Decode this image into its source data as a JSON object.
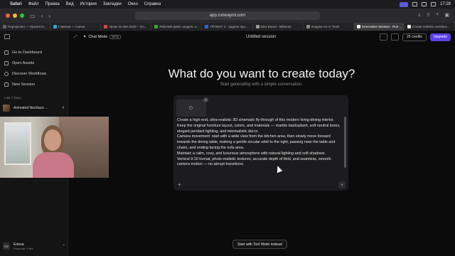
{
  "menubar": {
    "app": "Safari",
    "items": [
      "Файл",
      "Правка",
      "Вид",
      "История",
      "Закладки",
      "Окно",
      "Справка"
    ],
    "time": "17:28"
  },
  "browser": {
    "address": "app.runwayml.com",
    "tabs": [
      {
        "label": "Портфолио — Презента..."
      },
      {
        "label": "Главная — Canva"
      },
      {
        "label": "Уроки по Wei 2025 – Go..."
      },
      {
        "label": "Рабочий файл, модель 4..."
      },
      {
        "label": "ПРОЕКТ 2 - Задачи про..."
      },
      {
        "label": "New Board - Miliarote"
      },
      {
        "label": "Imagine Art AI Tools"
      },
      {
        "label": "Generative Session - Run..."
      },
      {
        "label": "Create realistic necklace..."
      }
    ],
    "active_tab": 7
  },
  "sidebar": {
    "nav": [
      {
        "label": "Go to Dashboard",
        "icon": "dashboard-icon"
      },
      {
        "label": "Open Assets",
        "icon": "folder-icon"
      },
      {
        "label": "Discover Workflows",
        "icon": "globe-icon"
      },
      {
        "label": "New Session",
        "icon": "plus-icon"
      }
    ],
    "section_title": "Last 7 Days",
    "sessions": [
      {
        "label": "Animated Necklace ...",
        "count": "4"
      }
    ],
    "user": {
      "initials": "ER",
      "name": "Елена",
      "plan": "Personal · Free"
    }
  },
  "topbar": {
    "mode_label": "Chat Mode",
    "beta": "BETA",
    "session_title": "Untitled session",
    "credits": "25 credits",
    "upgrade": "Upgrade"
  },
  "hero": {
    "title": "What do you want to create today?",
    "subtitle": "Start generating with a simple conversation."
  },
  "composer": {
    "prompt_lines": [
      "Create a high-end, ultra-realistic 3D cinematic fly-through of this modern living-dining interior.",
      "Keep the original furniture layout, colors, and materials — marble backsplash, soft neutral tones, elegant pendant lighting, and minimalistic decor.",
      "Camera movement: start with a wide view from the kitchen area, then slowly move forward towards the dining table, making a gentle circular orbit to the right, passing near the table and chairs, and ending facing the sofa area.",
      "Maintain a calm, cozy, and luxurious atmosphere with natural lighting and soft shadows.",
      "Vertical 9:16 format, photo-realistic textures, accurate depth of field, and seamless, smooth camera motion — no abrupt transitions."
    ]
  },
  "footer": {
    "tool_mode_button": "Start with Tool Mode instead"
  }
}
